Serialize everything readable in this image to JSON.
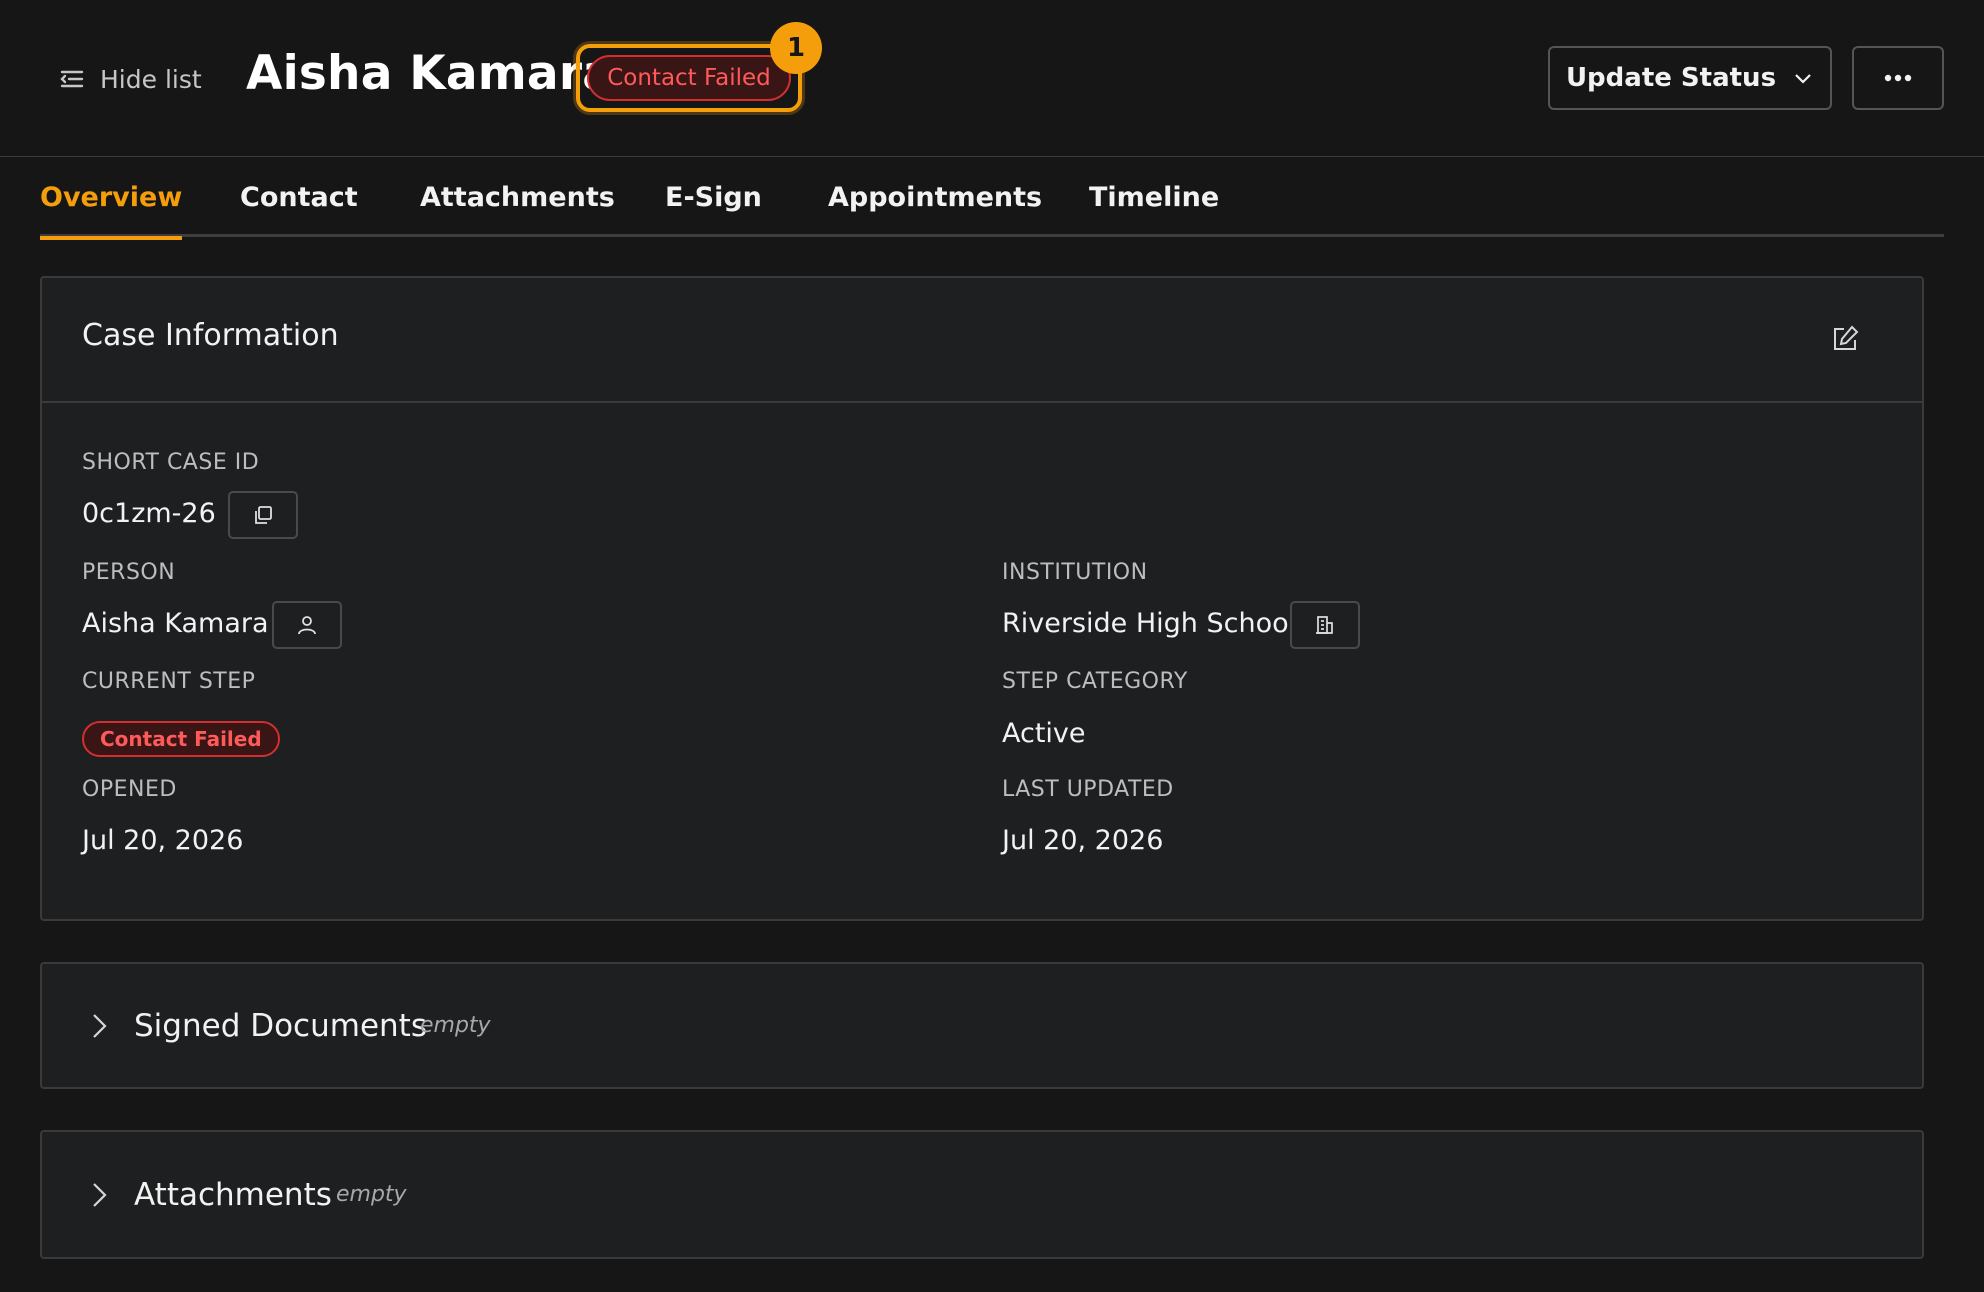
{
  "header": {
    "hide_list_label": "Hide list",
    "title": "Aisha Kamara",
    "status": "Contact Failed",
    "notification_count": "1",
    "update_status_label": "Update Status",
    "more_label": "more"
  },
  "tabs": [
    {
      "label": "Overview",
      "active": true
    },
    {
      "label": "Contact",
      "active": false
    },
    {
      "label": "Attachments",
      "active": false
    },
    {
      "label": "E-Sign",
      "active": false
    },
    {
      "label": "Appointments",
      "active": false
    },
    {
      "label": "Timeline",
      "active": false
    }
  ],
  "case_info": {
    "title": "Case Information",
    "short_case_id_label": "SHORT CASE ID",
    "short_case_id": "0c1zm-26",
    "person_label": "PERSON",
    "person": "Aisha Kamara",
    "institution_label": "INSTITUTION",
    "institution": "Riverside High School",
    "current_step_label": "CURRENT STEP",
    "current_step": "Contact Failed",
    "step_category_label": "STEP CATEGORY",
    "step_category": "Active",
    "opened_label": "OPENED",
    "opened": "Jul 20, 2026",
    "last_updated_label": "LAST UPDATED",
    "last_updated": "Jul 20, 2026"
  },
  "sections": {
    "signed_documents": {
      "title": "Signed Documents",
      "state": "empty"
    },
    "attachments": {
      "title": "Attachments",
      "state": "empty"
    }
  },
  "colors": {
    "accent": "#f59e0b",
    "danger": "#d32f2f",
    "background": "#161616",
    "card": "#1e1f20"
  }
}
